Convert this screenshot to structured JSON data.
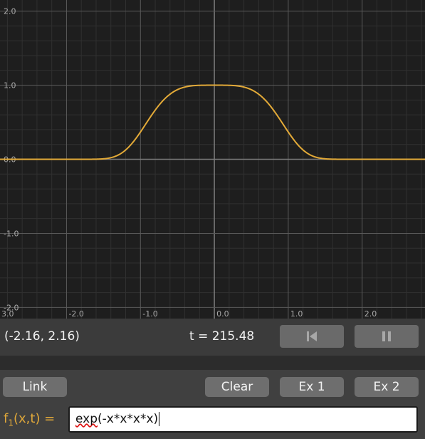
{
  "plot": {
    "x_range": [
      -2.9,
      2.85
    ],
    "y_range": [
      -2.15,
      2.15
    ],
    "x_ticks": [
      {
        "v": -3.0,
        "label": "3.0"
      },
      {
        "v": -2.0,
        "label": "-2.0"
      },
      {
        "v": -1.0,
        "label": "-1.0"
      },
      {
        "v": 0.0,
        "label": "0.0"
      },
      {
        "v": 1.0,
        "label": "1.0"
      },
      {
        "v": 2.0,
        "label": "2.0"
      }
    ],
    "y_ticks": [
      {
        "v": 2.0,
        "label": "2.0"
      },
      {
        "v": 1.0,
        "label": "1.0"
      },
      {
        "v": 0.0,
        "label": "0.0"
      },
      {
        "v": -1.0,
        "label": "-1.0"
      },
      {
        "v": -2.0,
        "label": "-2.0"
      }
    ],
    "curve_color": "#e3aa38",
    "grid_major_color": "#5a5a5a",
    "grid_minor_color": "#303030",
    "axis_color": "#7a7a7a"
  },
  "status": {
    "coords": "(-2.16, 2.16)",
    "time": "t = 215.48",
    "reset_icon": "skip-back-icon",
    "pause_icon": "pause-icon"
  },
  "controls": {
    "link": "Link",
    "clear": "Clear",
    "ex1": "Ex 1",
    "ex2": "Ex 2",
    "fx_label_prefix": "f",
    "fx_label_sub": "1",
    "fx_label_suffix": "(x,t) =",
    "expr_underlined": "exp",
    "expr_rest": "(-x*x*x*x)"
  }
}
